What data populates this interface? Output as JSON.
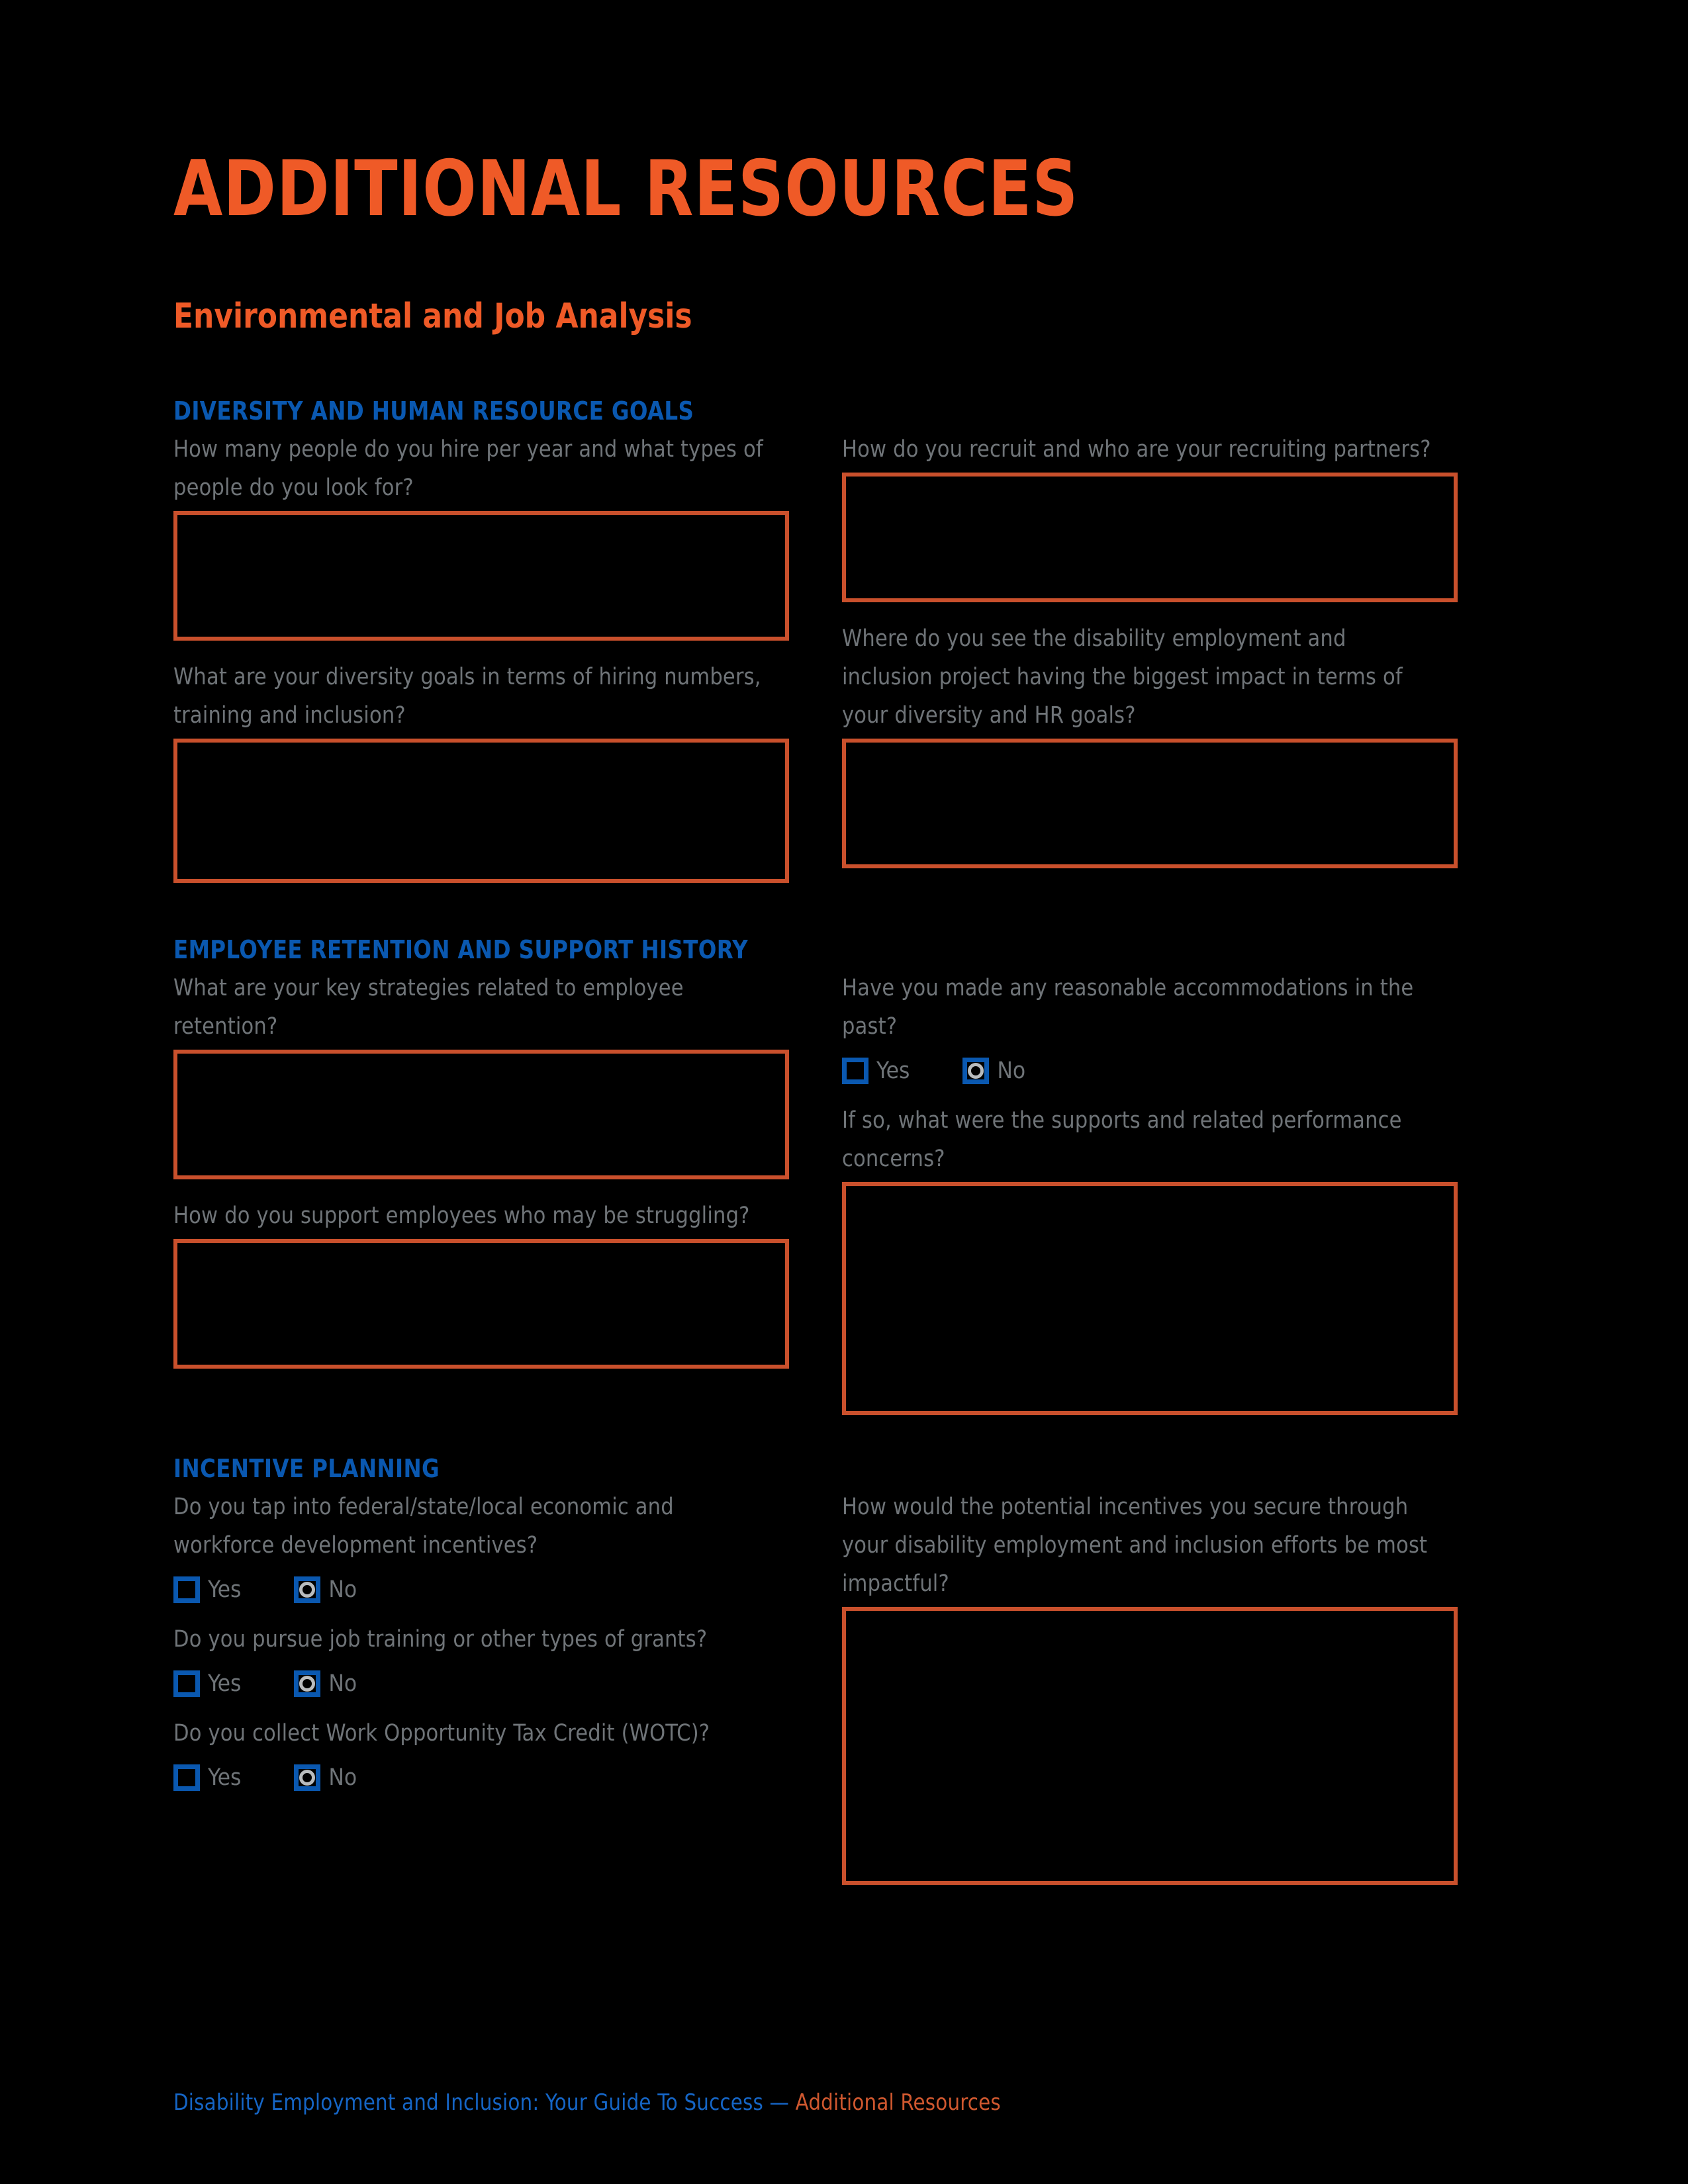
{
  "header": {
    "title": "ADDITIONAL RESOURCES",
    "subtitle": "Environmental and Job Analysis"
  },
  "colors": {
    "title_orange": "#ef5a27",
    "box_orange": "#c9502c",
    "section_blue": "#0a58b0",
    "footer_blue": "#1565c5",
    "footer_orange": "#d0582f",
    "body_gray": "#6f7478",
    "background": "#000000",
    "ring_gray": "#b9bcbe"
  },
  "choices": {
    "yes_label": "Yes",
    "no_label": "No"
  },
  "sections": [
    {
      "heading": "DIVERSITY AND HUMAN RESOURCE GOALS",
      "left": [
        {
          "question": "How many people do you hire per year and what types of people do you look for?"
        },
        {
          "question": "What are your diversity goals in terms of hiring numbers, training and inclusion?"
        }
      ],
      "right": [
        {
          "question": "How do you recruit and who are your recruiting partners?"
        },
        {
          "question": "Where do you see the disability employment and inclusion project having the biggest impact in terms of your diversity and HR goals?"
        }
      ]
    },
    {
      "heading": "EMPLOYEE RETENTION AND SUPPORT HISTORY",
      "left": [
        {
          "question": "What are your key strategies related to employee retention?"
        },
        {
          "question": "How do you support employees who may be struggling?"
        }
      ],
      "right": [
        {
          "question": "Have you made any reasonable accommodations in the past?"
        },
        {
          "question": "If so, what were the supports and related performance concerns?"
        }
      ]
    },
    {
      "heading": "INCENTIVE PLANNING",
      "left": [
        {
          "question": "Do you tap into federal/state/local economic and workforce development incentives?"
        },
        {
          "question": "Do you pursue job training or other types of grants?"
        },
        {
          "question": "Do you collect Work Opportunity Tax Credit (WOTC)?"
        }
      ],
      "right": [
        {
          "question": "How would the potential incentives you secure through your disability employment and inclusion efforts be most impactful?"
        }
      ]
    }
  ],
  "footer": {
    "blue_text": "Disability Employment and Inclusion: Your Guide To Success — ",
    "orange_text": "Additional Resources"
  }
}
